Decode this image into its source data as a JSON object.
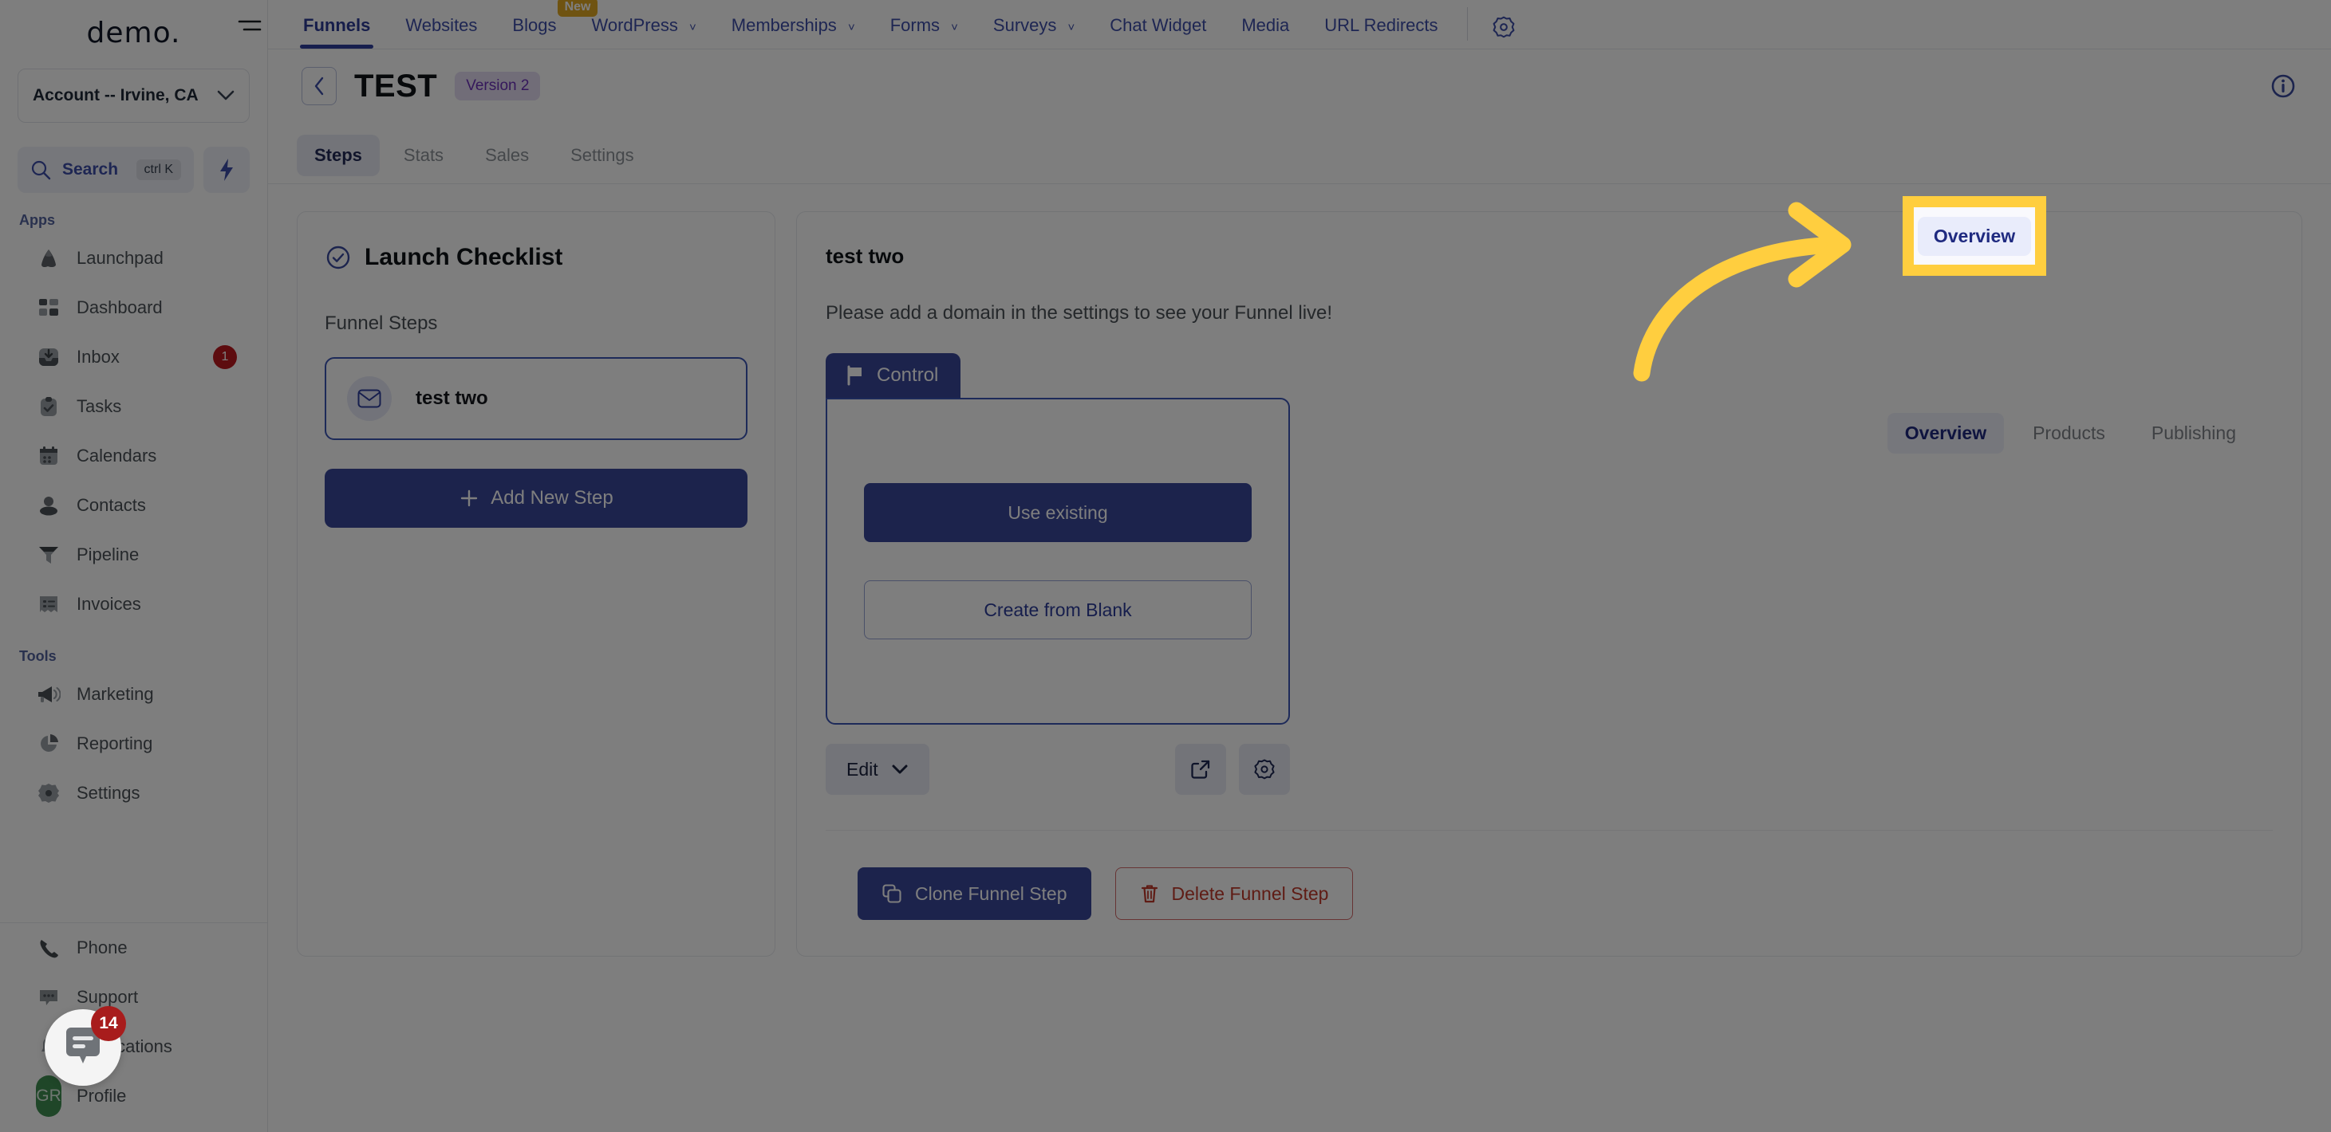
{
  "sidebar": {
    "brand": "demo.",
    "account_selector": {
      "label": "Account -- Irvine, CA",
      "caret": "chevron-down-icon"
    },
    "search": {
      "label": "Search",
      "shortcut": "ctrl K"
    },
    "sections": [
      {
        "title": "Apps",
        "items": [
          {
            "label": "Launchpad",
            "icon": "rocket-icon",
            "badge": ""
          },
          {
            "label": "Dashboard",
            "icon": "grid-icon",
            "badge": ""
          },
          {
            "label": "Inbox",
            "icon": "inbox-icon",
            "badge": "1"
          },
          {
            "label": "Tasks",
            "icon": "clipboard-check-icon",
            "badge": ""
          },
          {
            "label": "Calendars",
            "icon": "calendar-icon",
            "badge": ""
          },
          {
            "label": "Contacts",
            "icon": "person-icon",
            "badge": ""
          },
          {
            "label": "Pipeline",
            "icon": "funnel-icon",
            "badge": ""
          },
          {
            "label": "Invoices",
            "icon": "invoice-icon",
            "badge": ""
          }
        ]
      },
      {
        "title": "Tools",
        "items": [
          {
            "label": "Marketing",
            "icon": "megaphone-icon",
            "badge": ""
          },
          {
            "label": "Reporting",
            "icon": "pie-chart-icon",
            "badge": ""
          },
          {
            "label": "Settings",
            "icon": "gear-icon",
            "badge": ""
          }
        ]
      }
    ],
    "bottom_items": [
      {
        "label": "Phone",
        "icon": "phone-icon",
        "badge": ""
      },
      {
        "label": "Support",
        "icon": "chat-dots-icon",
        "badge": ""
      },
      {
        "label": "Notifications",
        "icon": "bell-icon",
        "badge": ""
      },
      {
        "label": "Profile",
        "icon": "avatar-icon",
        "badge": ""
      }
    ],
    "avatar_initials": "GR"
  },
  "topnav": {
    "items": [
      {
        "label": "Funnels",
        "active": true,
        "caret": false,
        "badge": ""
      },
      {
        "label": "Websites",
        "active": false,
        "caret": false,
        "badge": ""
      },
      {
        "label": "Blogs",
        "active": false,
        "caret": false,
        "badge": "New"
      },
      {
        "label": "WordPress",
        "active": false,
        "caret": true,
        "badge": ""
      },
      {
        "label": "Memberships",
        "active": false,
        "caret": true,
        "badge": ""
      },
      {
        "label": "Forms",
        "active": false,
        "caret": true,
        "badge": ""
      },
      {
        "label": "Surveys",
        "active": false,
        "caret": true,
        "badge": ""
      },
      {
        "label": "Chat Widget",
        "active": false,
        "caret": false,
        "badge": ""
      },
      {
        "label": "Media",
        "active": false,
        "caret": false,
        "badge": ""
      },
      {
        "label": "URL Redirects",
        "active": false,
        "caret": false,
        "badge": ""
      }
    ],
    "settings_icon": "gear-icon",
    "caret_glyph": "˅"
  },
  "page_header": {
    "back_icon": "chevron-left-icon",
    "title": "TEST",
    "version_badge": "Version 2",
    "info_icon": "info-circle-icon"
  },
  "sub_tabs": [
    {
      "label": "Steps",
      "active": true
    },
    {
      "label": "Stats",
      "active": false
    },
    {
      "label": "Sales",
      "active": false
    },
    {
      "label": "Settings",
      "active": false
    }
  ],
  "launch_checklist": {
    "title": "Launch Checklist",
    "check_icon": "check-circle-icon",
    "funnel_steps_label": "Funnel Steps",
    "steps": [
      {
        "name": "test two",
        "icon": "envelope-icon"
      }
    ],
    "add_step_label": "Add New Step",
    "add_step_icon": "plus-icon"
  },
  "step_detail": {
    "title": "test two",
    "domain_note": "Please add a domain in the settings to see your Funnel live!",
    "control_tab": {
      "label": "Control",
      "icon": "flag-icon"
    },
    "use_existing_label": "Use existing",
    "create_blank_label": "Create from Blank",
    "edit_label": "Edit",
    "edit_caret": "chevron-down-icon",
    "external_link_icon": "external-link-icon",
    "settings_icon": "gear-icon",
    "clone_label": "Clone Funnel Step",
    "clone_icon": "copy-icon",
    "delete_label": "Delete Funnel Step",
    "delete_icon": "trash-icon"
  },
  "right_tabs": [
    {
      "label": "Overview",
      "active": true,
      "highlighted": true
    },
    {
      "label": "Products",
      "active": false,
      "highlighted": false
    },
    {
      "label": "Publishing",
      "active": false,
      "highlighted": false
    }
  ],
  "chat_widget": {
    "badge": "14",
    "icon": "chat-bubble-icon"
  },
  "colors": {
    "accent_blue": "#39479b",
    "link_blue": "#3e4ea8",
    "highlight_yellow": "#ffce3f",
    "danger_red": "#c0392b",
    "badge_red": "#bd1a20",
    "new_badge": "#e0a924",
    "version_purple": "#6b31b8",
    "avatar_green": "#3f8f52"
  }
}
